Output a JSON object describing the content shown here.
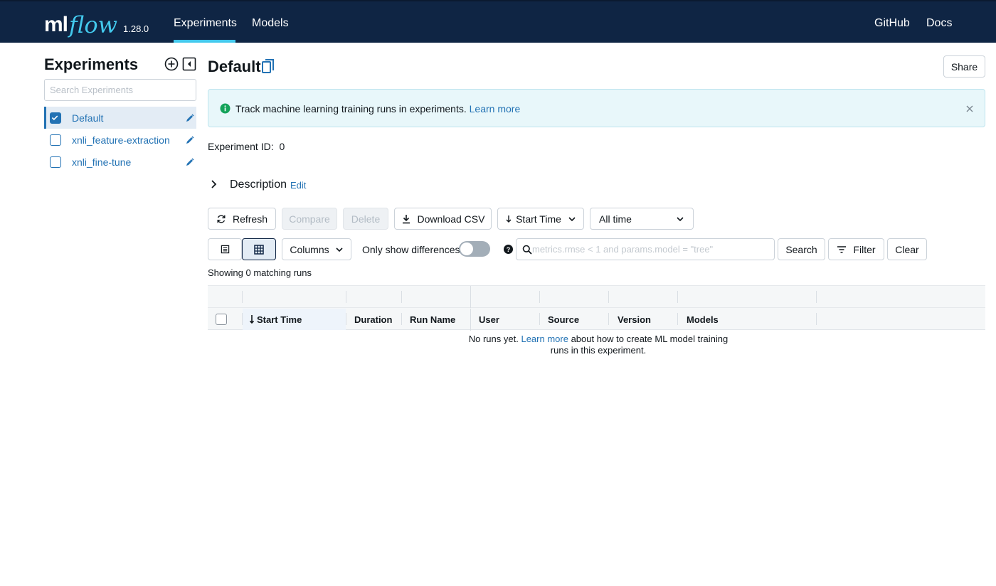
{
  "app": {
    "logo_main": "ml",
    "logo_accent": "flow",
    "version": "1.28.0",
    "nav": [
      {
        "label": "Experiments",
        "active": true
      },
      {
        "label": "Models",
        "active": false
      }
    ],
    "nav_right": [
      {
        "label": "GitHub"
      },
      {
        "label": "Docs"
      }
    ],
    "colors": {
      "nav_bg": "#0f2544",
      "accent": "#43c9ed",
      "link": "#2272b4"
    }
  },
  "sidebar": {
    "title": "Experiments",
    "search_placeholder": "Search Experiments",
    "items": [
      {
        "label": "Default",
        "checked": true
      },
      {
        "label": "xnli_feature-extraction",
        "checked": false
      },
      {
        "label": "xnli_fine-tune",
        "checked": false
      }
    ]
  },
  "main": {
    "title": "Default",
    "share_label": "Share",
    "banner": {
      "text": "Track machine learning training runs in experiments.",
      "link": "Learn more"
    },
    "experiment_id_label": "Experiment ID:",
    "experiment_id": "0",
    "description_label": "Description",
    "description_edit": "Edit",
    "toolbar": {
      "refresh": "Refresh",
      "compare": "Compare",
      "delete": "Delete",
      "download_csv": "Download CSV",
      "sort": "Start Time",
      "time_range": "All time"
    },
    "filters": {
      "columns": "Columns",
      "only_diff": "Only show differences",
      "only_diff_on": false,
      "search_placeholder": "metrics.rmse < 1 and params.model = \"tree\"",
      "search": "Search",
      "filter": "Filter",
      "clear": "Clear"
    },
    "showing": "Showing 0 matching runs",
    "table": {
      "columns": [
        "Start Time",
        "Duration",
        "Run Name",
        "User",
        "Source",
        "Version",
        "Models"
      ]
    },
    "empty": {
      "before": "No runs yet.",
      "link": "Learn more",
      "after": "about how to create ML model training runs in this experiment."
    }
  }
}
